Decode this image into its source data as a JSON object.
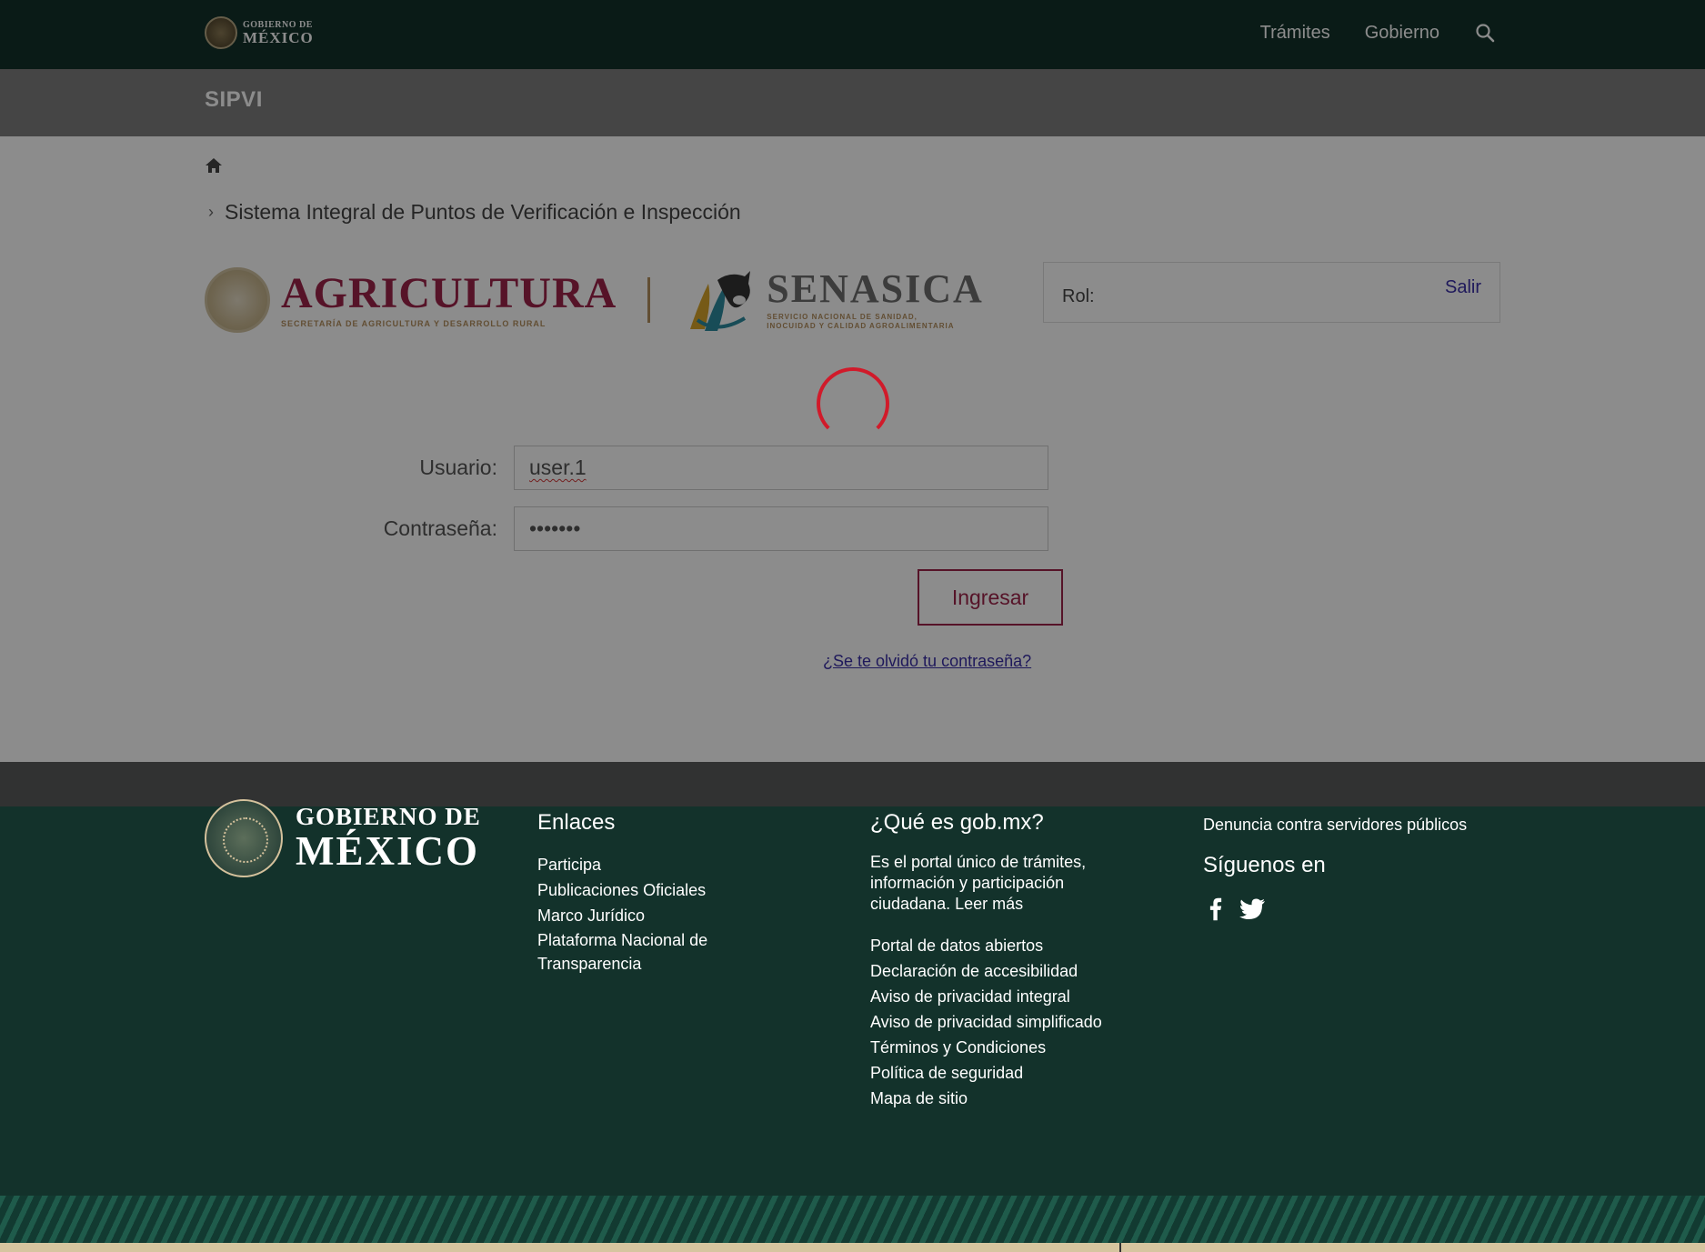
{
  "header": {
    "brand_line1": "GOBIERNO DE",
    "brand_line2": "MÉXICO",
    "nav": [
      "Trámites",
      "Gobierno"
    ],
    "search_icon": "search-icon"
  },
  "app": {
    "title": "SIPVI"
  },
  "breadcrumb": {
    "home_icon": "home-icon",
    "current": "Sistema Integral de Puntos de Verificación e Inspección"
  },
  "logos": {
    "agricultura": "AGRICULTURA",
    "agricultura_sub": "SECRETARÍA DE AGRICULTURA Y DESARROLLO RURAL",
    "senasica": "SENASICA",
    "senasica_sub1": "SERVICIO NACIONAL DE SANIDAD,",
    "senasica_sub2": "INOCUIDAD Y CALIDAD AGROALIMENTARIA"
  },
  "session": {
    "rol_label": "Rol:",
    "logout_label": "Salir"
  },
  "login": {
    "user_label": "Usuario:",
    "user_value": "user.1",
    "password_label": "Contraseña:",
    "password_value": "•••••••",
    "submit_label": "Ingresar",
    "forgot_label": "¿Se te olvidó tu contraseña?"
  },
  "footer": {
    "logo_line1": "GOBIERNO DE",
    "logo_line2": "MÉXICO",
    "enlaces_title": "Enlaces",
    "enlaces": [
      "Participa",
      "Publicaciones Oficiales",
      "Marco Jurídico",
      "Plataforma Nacional de Transparencia"
    ],
    "gob_title": "¿Qué es gob.mx?",
    "gob_desc": "Es el portal único de trámites, información y participación ciudadana. Leer más",
    "gob_links": [
      "Portal de datos abiertos",
      "Declaración de accesibilidad",
      "Aviso de privacidad integral",
      "Aviso de privacidad simplificado",
      "Términos y Condiciones",
      "Política de seguridad",
      "Mapa de sitio"
    ],
    "denuncia": "Denuncia contra servidores públicos",
    "social_title": "Síguenos en",
    "social_icons": [
      "facebook-icon",
      "twitter-icon"
    ]
  },
  "colors": {
    "header_bg": "#13322b",
    "subbar_bg": "#7e7f7f",
    "accent": "#9d2449",
    "gold": "#b38e5d",
    "spinner": "#d11a2a",
    "link": "#3a2fa7"
  }
}
